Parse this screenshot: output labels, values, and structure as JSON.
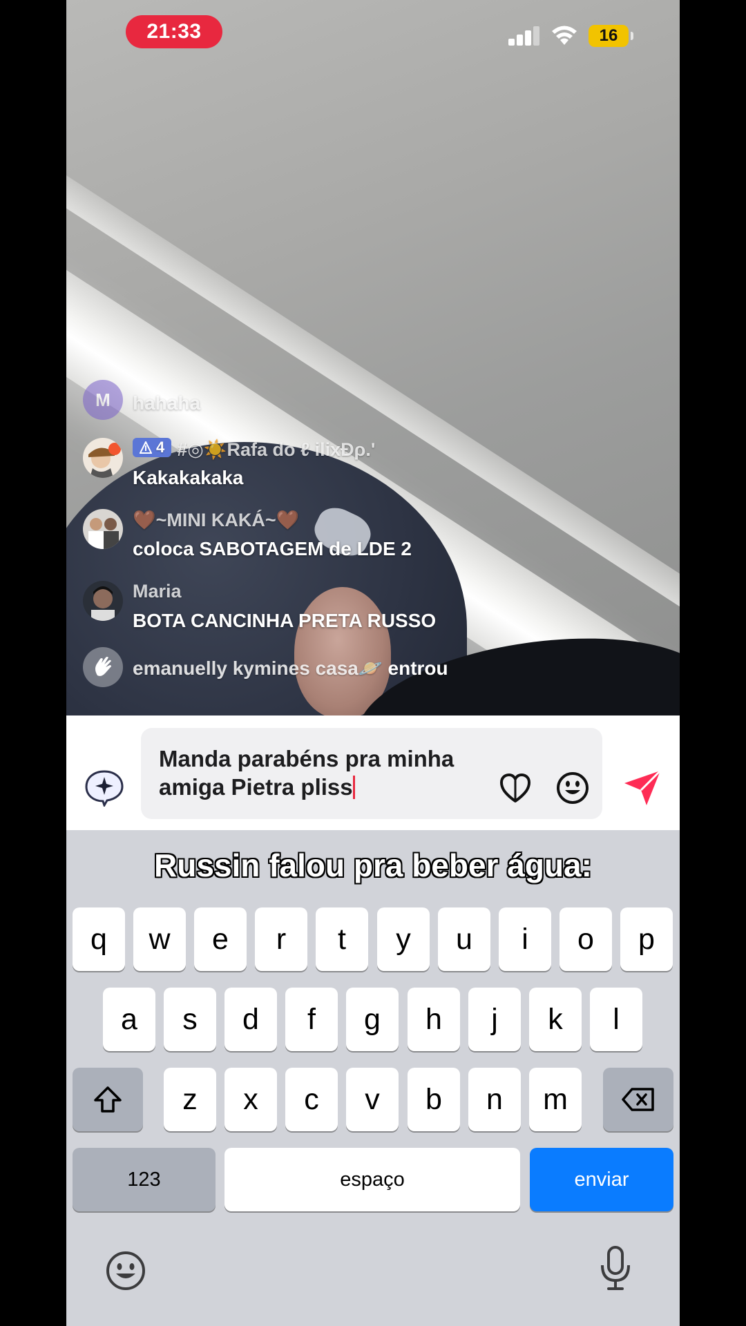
{
  "status_bar": {
    "time": "21:33",
    "battery": "16",
    "colors": {
      "clock_pill": "#e8283f",
      "battery": "#f2c300"
    }
  },
  "comments": [
    {
      "user": "M",
      "text": "hahaha"
    },
    {
      "badge_level": "4",
      "user": "#◎☀️Rafa do ℓ ilixÐρ.'",
      "text": "Kakakakaka"
    },
    {
      "user": "🤎~MINI KAKÁ~🤎",
      "text": "coloca SABOTAGEM de LDE 2"
    },
    {
      "user": "Maria",
      "text": "BOTA CANCINHA PRETA RUSSO"
    },
    {
      "user": "emanuelly kymines casa🪐",
      "text": "entrou"
    }
  ],
  "input": {
    "value": "Manda parabéns pra minha amiga Pietra pliss",
    "icons": [
      "ai-sparkle-icon",
      "heart-icon",
      "emoji-icon",
      "send-icon"
    ],
    "accent": "#fe2c55"
  },
  "keyboard": {
    "overlay_caption": "Russin falou pra beber água:",
    "row1": [
      "q",
      "w",
      "e",
      "r",
      "t",
      "y",
      "u",
      "i",
      "o",
      "p"
    ],
    "row2": [
      "a",
      "s",
      "d",
      "f",
      "g",
      "h",
      "j",
      "k",
      "l"
    ],
    "row3": [
      "z",
      "x",
      "c",
      "v",
      "b",
      "n",
      "m"
    ],
    "numbers_label": "123",
    "space_label": "espaço",
    "send_label": "enviar",
    "send_color": "#0a7cff"
  }
}
